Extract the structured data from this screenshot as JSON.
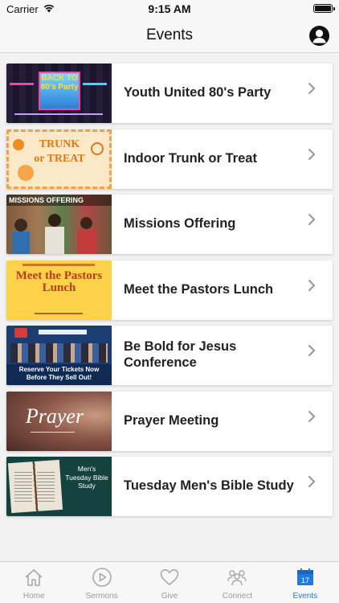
{
  "status": {
    "carrier": "Carrier",
    "time": "9:15 AM"
  },
  "nav": {
    "title": "Events"
  },
  "events": [
    {
      "title": "Youth United 80's Party",
      "thumb_text": "BACK TO 80's Party"
    },
    {
      "title": "Indoor Trunk or Treat",
      "thumb_text": "TRUNK or TREAT"
    },
    {
      "title": "Missions Offering",
      "thumb_text": "MISSIONS OFFERING"
    },
    {
      "title": "Meet the Pastors Lunch",
      "thumb_text": "Meet the Pastors Lunch"
    },
    {
      "title": "Be Bold for Jesus Conference",
      "thumb_text": "Reserve Your Tickets Now Before They Sell Out!"
    },
    {
      "title": "Prayer Meeting",
      "thumb_text": "Prayer"
    },
    {
      "title": "Tuesday Men's Bible Study",
      "thumb_text": "Men's Tuesday Bible Study"
    }
  ],
  "tabs": [
    {
      "label": "Home",
      "icon": "home-icon"
    },
    {
      "label": "Sermons",
      "icon": "play-icon"
    },
    {
      "label": "Give",
      "icon": "heart-icon"
    },
    {
      "label": "Connect",
      "icon": "people-icon"
    },
    {
      "label": "Events",
      "icon": "calendar-icon",
      "badge": "17",
      "active": true
    }
  ],
  "colors": {
    "accent": "#1f7ae0",
    "inactive": "#9a9a9a"
  }
}
